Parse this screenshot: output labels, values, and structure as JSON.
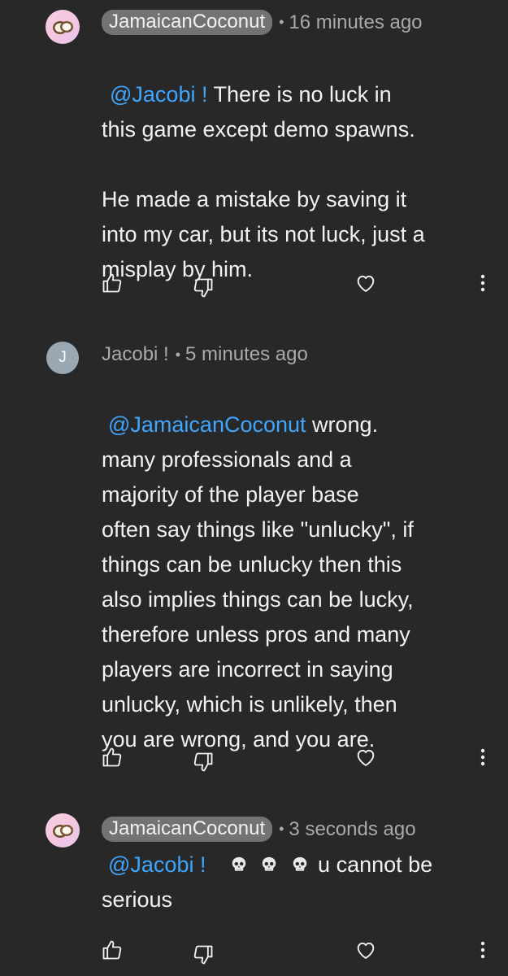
{
  "comments": [
    {
      "author": "JamaicanCoconut",
      "author_style": "chip",
      "separator": "•",
      "time": "16 minutes ago",
      "mention": "@Jacobi !",
      "text": " There is no luck in\nthis game except demo spawns.\n\nHe made a mistake by saving it\ninto my car, but its not luck, just a\nmisplay by him.",
      "avatar_icon": "coconut-icon"
    },
    {
      "author": "Jacobi !",
      "author_style": "plain",
      "separator": "•",
      "time": "5 minutes ago",
      "mention": "@JamaicanCoconut",
      "text": "  wrong.\nmany professionals and a\nmajority of the player base\noften say things like \"unlucky\", if\nthings can be unlucky then this\nalso implies things can be lucky,\ntherefore unless pros and many\nplayers are incorrect in saying\nunlucky, which is unlikely, then\nyou are wrong, and you are.",
      "avatar_letter": "J"
    },
    {
      "author": "JamaicanCoconut",
      "author_style": "chip",
      "separator": "•",
      "time": "3 seconds ago",
      "mention": "@Jacobi !",
      "emojis": [
        "skull-emoji",
        "skull-emoji",
        "skull-emoji"
      ],
      "text_after_emoji": " u cannot be",
      "text_line2": "serious",
      "avatar_icon": "coconut-icon"
    }
  ],
  "icons": {
    "like": "thumbs-up-icon",
    "dislike": "thumbs-down-icon",
    "heart": "heart-icon",
    "more": "more-vertical-icon"
  },
  "colors": {
    "background": "#282828",
    "mention": "#3ea6ff",
    "chip": "#737373",
    "meta": "#aaaaaa",
    "text": "#f1f1f1"
  }
}
